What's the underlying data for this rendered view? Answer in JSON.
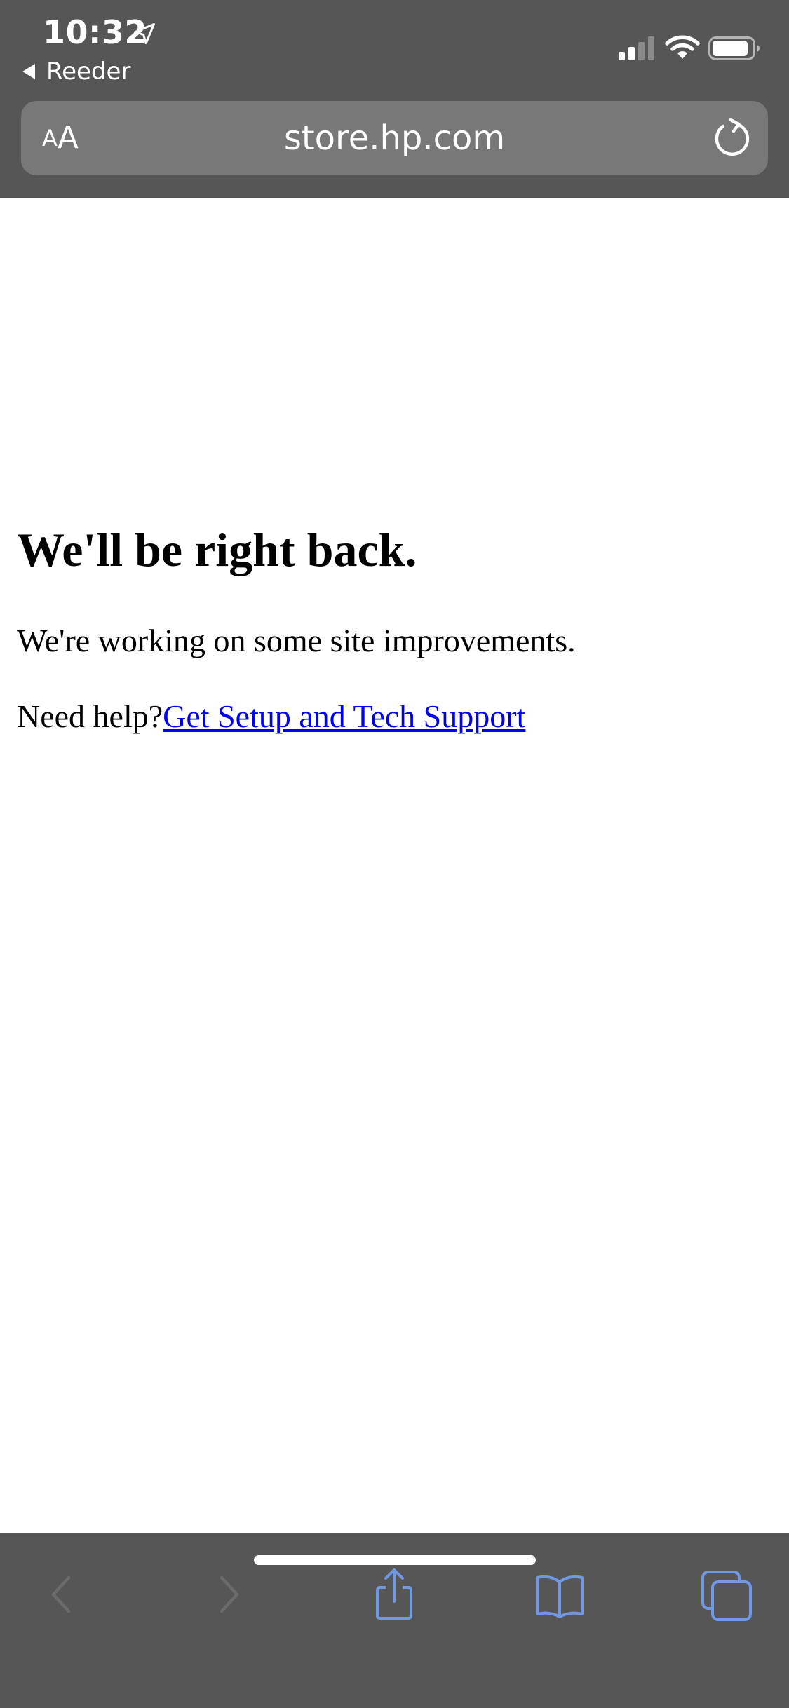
{
  "status_bar": {
    "time": "10:32",
    "back_app": "Reeder",
    "icons": [
      "location-arrow-icon",
      "cellular-signal-icon",
      "wifi-icon",
      "battery-icon"
    ]
  },
  "address_bar": {
    "text_size_small": "A",
    "text_size_big": "A",
    "url": "store.hp.com",
    "reload_icon": "reload-icon"
  },
  "page": {
    "heading": "We'll be right back.",
    "message": "We're working on some site improvements.",
    "help_prefix": "Need help?",
    "help_link": "Get Setup and Tech Support"
  },
  "toolbar": {
    "items": [
      {
        "name": "back",
        "icon": "chevron-left-icon",
        "enabled": false
      },
      {
        "name": "forward",
        "icon": "chevron-right-icon",
        "enabled": false
      },
      {
        "name": "share",
        "icon": "share-icon",
        "enabled": true
      },
      {
        "name": "bookmarks",
        "icon": "book-icon",
        "enabled": true
      },
      {
        "name": "tabs",
        "icon": "tabs-icon",
        "enabled": true
      }
    ]
  },
  "colors": {
    "chrome_background": "#565656",
    "url_field": "#787878",
    "toolbar_active": "#6f98e6",
    "toolbar_disabled": "#6b6b6b",
    "link": "#0000ee"
  }
}
